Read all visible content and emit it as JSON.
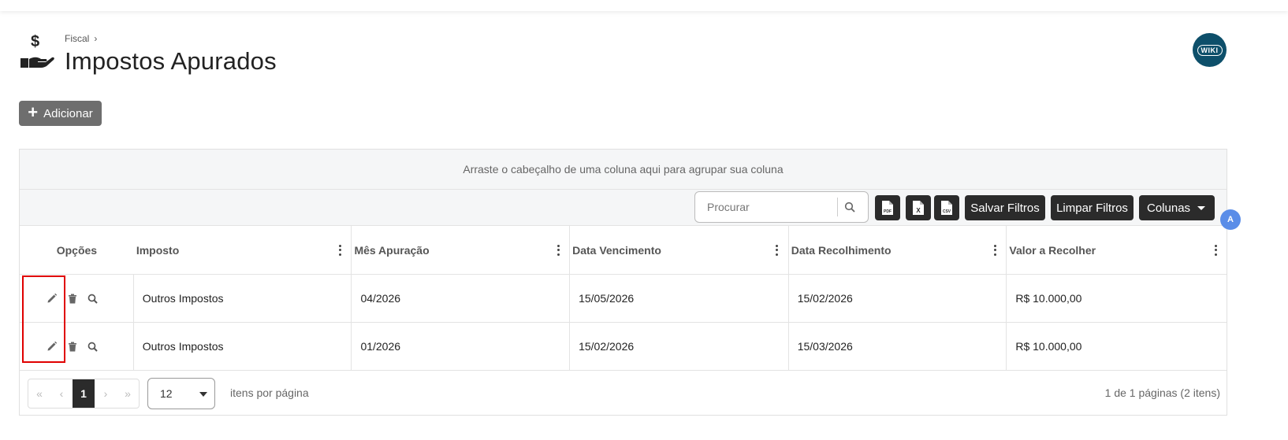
{
  "breadcrumb": {
    "parent": "Fiscal"
  },
  "page": {
    "title": "Impostos Apurados",
    "icon": "hand-dollar-icon"
  },
  "wiki": {
    "label": "WIKI"
  },
  "toolbar": {
    "add_label": "Adicionar",
    "group_hint": "Arraste o cabeçalho de uma coluna aqui para agrupar sua coluna",
    "search_placeholder": "Procurar",
    "export_pdf_label": "PDF",
    "export_xls_label": "X",
    "export_csv_label": "CSV",
    "save_filters_label": "Salvar Filtros",
    "clear_filters_label": "Limpar Filtros",
    "columns_label": "Colunas"
  },
  "table": {
    "columns": [
      "Opções",
      "Imposto",
      "Mês Apuração",
      "Data Vencimento",
      "Data Recolhimento",
      "Valor a Recolher"
    ],
    "rows": [
      {
        "imposto": "Outros Impostos",
        "mes": "04/2026",
        "vencimento": "15/05/2026",
        "recolhimento": "15/02/2026",
        "valor": "R$ 10.000,00"
      },
      {
        "imposto": "Outros Impostos",
        "mes": "01/2026",
        "vencimento": "15/02/2026",
        "recolhimento": "15/03/2026",
        "valor": "R$ 10.000,00"
      }
    ]
  },
  "pagination": {
    "current_page": "1",
    "page_size": "12",
    "per_page_label": "itens por página",
    "info": "1 de 1 páginas (2 itens)"
  },
  "colors": {
    "dark_button": "#2b2b2b",
    "add_button": "#6e6e6e",
    "highlight": "#e00000",
    "wiki_bg": "#0d4f6a"
  }
}
